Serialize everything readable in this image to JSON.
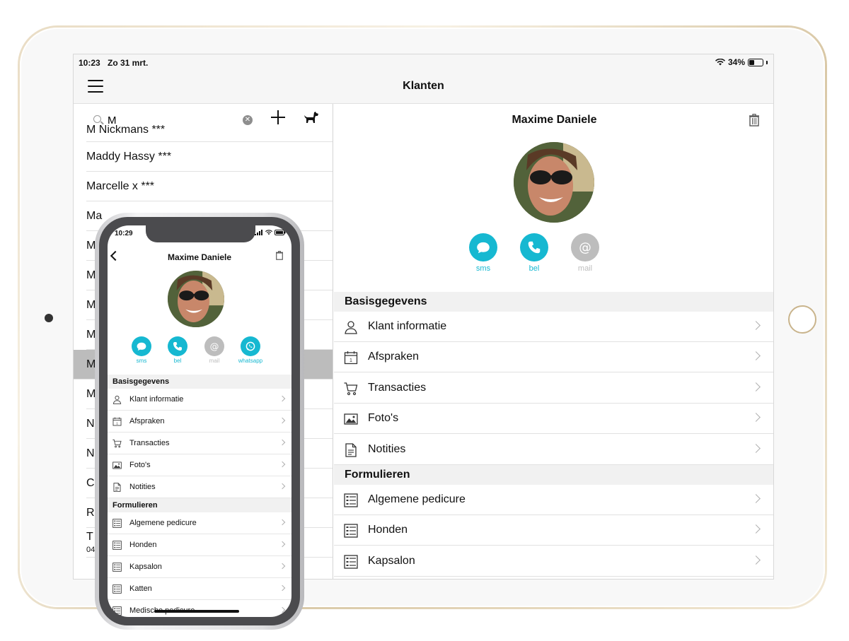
{
  "ipad": {
    "status": {
      "time": "10:23",
      "date": "Zo 31 mrt.",
      "battery": "34%"
    },
    "nav_title": "Klanten",
    "search": {
      "value": "M"
    },
    "list": [
      {
        "name": "M Nickmans ***"
      },
      {
        "name": "Maddy Hassy ***"
      },
      {
        "name": "Marcelle x ***"
      },
      {
        "name": "Ma"
      },
      {
        "name": "M"
      },
      {
        "name": "M"
      },
      {
        "name": "M"
      },
      {
        "name": "M"
      },
      {
        "name": "M",
        "selected": true
      },
      {
        "name": "M"
      },
      {
        "name": "N"
      },
      {
        "name": "N"
      },
      {
        "name": "C"
      },
      {
        "name": "R"
      },
      {
        "name": "T",
        "sub": "04"
      }
    ],
    "detail": {
      "name": "Maxime Daniele",
      "actions": [
        {
          "label": "sms",
          "color": "#16b8d1",
          "icon": "chat-icon"
        },
        {
          "label": "bel",
          "color": "#16b8d1",
          "icon": "phone-icon"
        },
        {
          "label": "mail",
          "color": "#bdbdbd",
          "icon": "at-icon"
        }
      ],
      "sections": [
        {
          "title": "Basisgegevens",
          "rows": [
            {
              "label": "Klant informatie",
              "icon": "user-icon"
            },
            {
              "label": "Afspraken",
              "icon": "calendar-icon"
            },
            {
              "label": "Transacties",
              "icon": "cart-icon"
            },
            {
              "label": "Foto's",
              "icon": "photo-icon"
            },
            {
              "label": "Notities",
              "icon": "note-icon"
            }
          ]
        },
        {
          "title": "Formulieren",
          "rows": [
            {
              "label": "Algemene pedicure",
              "icon": "form-icon"
            },
            {
              "label": "Honden",
              "icon": "form-icon"
            },
            {
              "label": "Kapsalon",
              "icon": "form-icon"
            }
          ]
        }
      ]
    }
  },
  "iphone": {
    "time": "10:29",
    "title": "Maxime Daniele",
    "actions": [
      {
        "label": "sms",
        "color": "#16b8d1",
        "icon": "chat-icon"
      },
      {
        "label": "bel",
        "color": "#16b8d1",
        "icon": "phone-icon"
      },
      {
        "label": "mail",
        "color": "#bdbdbd",
        "icon": "at-icon"
      },
      {
        "label": "whatsapp",
        "color": "#16b8d1",
        "icon": "whatsapp-icon"
      }
    ],
    "sections": [
      {
        "title": "Basisgegevens",
        "rows": [
          {
            "label": "Klant informatie",
            "icon": "user-icon"
          },
          {
            "label": "Afspraken",
            "icon": "calendar-icon"
          },
          {
            "label": "Transacties",
            "icon": "cart-icon"
          },
          {
            "label": "Foto's",
            "icon": "photo-icon"
          },
          {
            "label": "Notities",
            "icon": "note-icon"
          }
        ]
      },
      {
        "title": "Formulieren",
        "rows": [
          {
            "label": "Algemene pedicure",
            "icon": "form-icon"
          },
          {
            "label": "Honden",
            "icon": "form-icon"
          },
          {
            "label": "Kapsalon",
            "icon": "form-icon"
          },
          {
            "label": "Katten",
            "icon": "form-icon"
          },
          {
            "label": "Medische pedicure",
            "icon": "form-icon"
          }
        ]
      }
    ]
  }
}
